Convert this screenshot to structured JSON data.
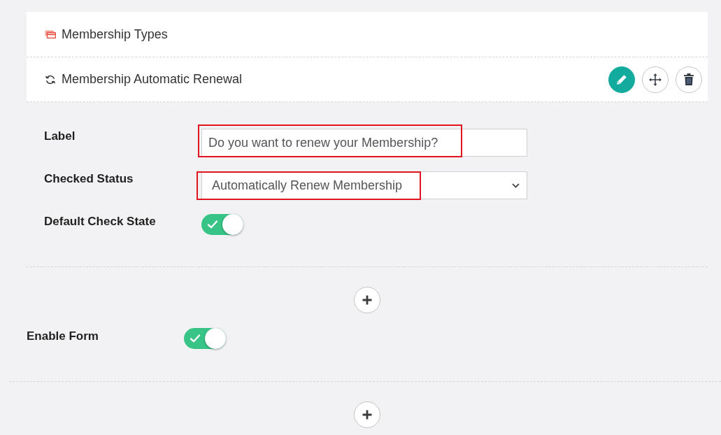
{
  "sections": [
    {
      "kind": "types",
      "title": "Membership Types"
    },
    {
      "kind": "renewal",
      "title": "Membership Automatic Renewal",
      "actions": [
        {
          "kind": "edit",
          "active": true
        },
        {
          "kind": "move",
          "active": false
        },
        {
          "kind": "delete",
          "active": false
        }
      ],
      "fields": [
        {
          "kind": "text",
          "label": "Label",
          "value": "Do you want to renew your Membership?",
          "highlighted": true
        },
        {
          "kind": "select",
          "label": "Checked Status",
          "value": "Automatically Renew Membership",
          "highlighted": true
        },
        {
          "kind": "toggle",
          "label": "Default Check State",
          "on": true
        }
      ]
    }
  ],
  "enable_form": {
    "label": "Enable Form",
    "on": true
  }
}
